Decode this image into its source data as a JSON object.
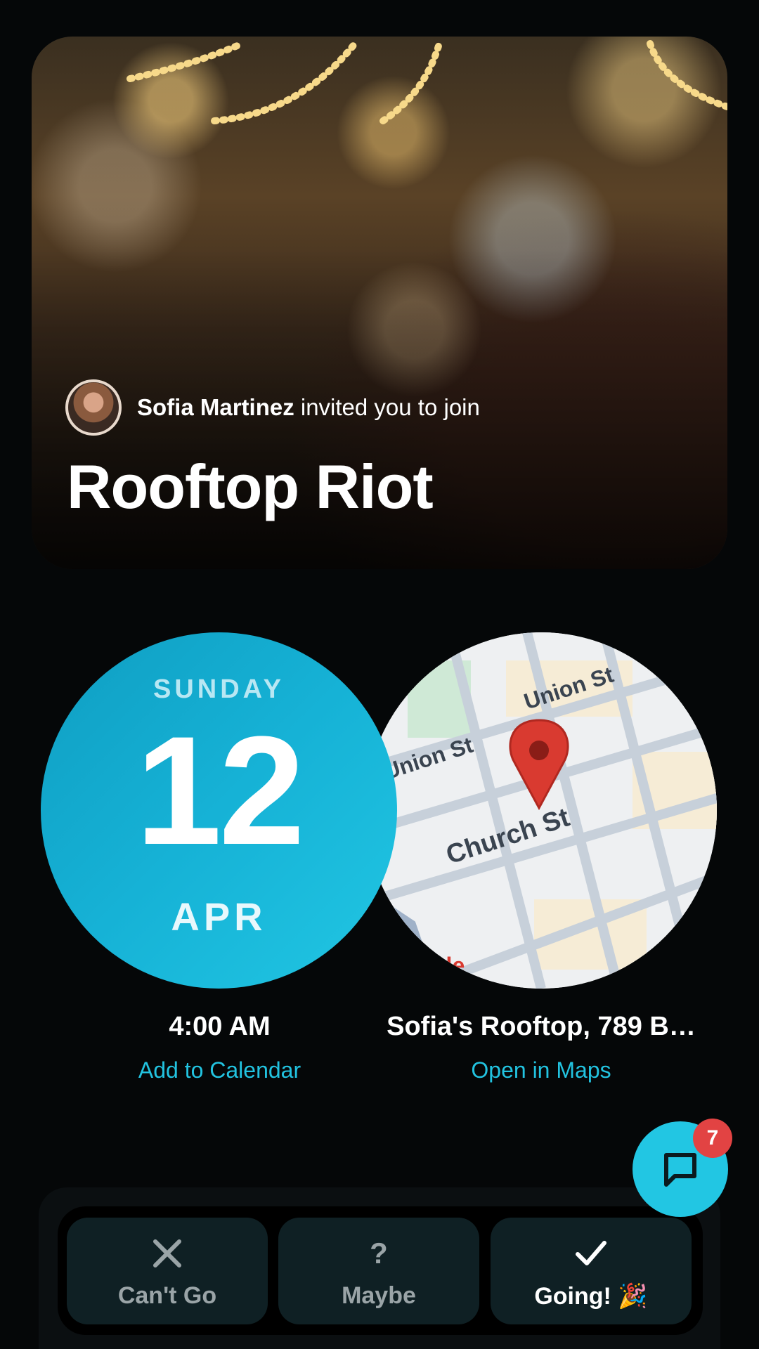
{
  "event": {
    "inviter_name": "Sofia Martinez",
    "invite_suffix": "invited you to join",
    "title": "Rooftop Riot"
  },
  "date": {
    "weekday": "SUNDAY",
    "day": "12",
    "month": "APR",
    "time": "4:00 AM",
    "add_calendar_label": "Add to Calendar"
  },
  "location": {
    "address": "Sofia's Rooftop, 789 B…",
    "open_maps_label": "Open in Maps",
    "map_labels": {
      "street1": "Union St",
      "street2": "Union St",
      "street3": "Church St",
      "logo_fragment": "gle"
    }
  },
  "chat": {
    "unread_count": "7"
  },
  "rsvp": {
    "cant_go": "Can't Go",
    "maybe": "Maybe",
    "maybe_icon": "?",
    "going": "Going! 🎉"
  },
  "colors": {
    "accent": "#22c6e3",
    "badge": "#e24343",
    "date_circle": "#16b2d6"
  }
}
